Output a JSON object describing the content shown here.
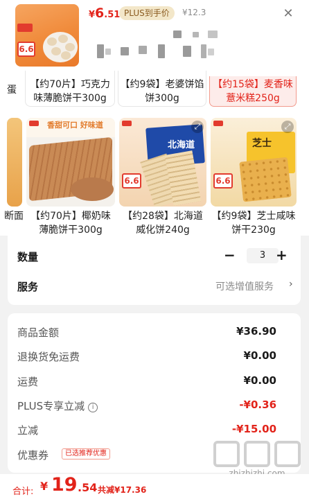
{
  "header": {
    "price": {
      "symbol": "¥",
      "int": "6",
      "dec": ".51"
    },
    "plus_tag": "PLUS到手价",
    "original_price": "¥12.3",
    "close_glyph": "✕",
    "thumb_tag": "6.6"
  },
  "products": [
    {
      "label": "蛋"
    },
    {
      "label": "【约70片】巧克力味薄脆饼干300g"
    },
    {
      "label": "【约9袋】老婆饼馅饼300g"
    },
    {
      "label": "【约15袋】麦香味薏米糕250g"
    },
    {
      "label": "断面"
    },
    {
      "label": "【约70片】椰奶味薄脆饼干300g",
      "banner": "香甜可口 好味道"
    },
    {
      "label": "【约28袋】北海道威化饼240g",
      "banner": "北海道",
      "tag": "6.6"
    },
    {
      "label": "【约9袋】芝士咸味饼干230g",
      "banner": "芝士",
      "tag": "6.6"
    }
  ],
  "quantity": {
    "label": "数量",
    "value": "3",
    "minus": "−",
    "plus": "+"
  },
  "service": {
    "label": "服务",
    "value": "可选增值服务",
    "chevron": "›"
  },
  "fees": [
    {
      "label": "商品金额",
      "value": "¥36.90",
      "red": false
    },
    {
      "label": "退换货免运费",
      "value": "¥0.00",
      "red": false
    },
    {
      "label": "运费",
      "value": "¥0.00",
      "red": false
    },
    {
      "label": "PLUS专享立减",
      "value": "-¥0.36",
      "red": true
    },
    {
      "label": "立减",
      "value": "-¥15.00",
      "red": true
    },
    {
      "label": "优惠券",
      "value": "",
      "red": true
    }
  ],
  "coupon_tag": "已选推荐优惠",
  "total": {
    "label": "合计:",
    "symbol": "¥",
    "int": "19",
    "dec": ".54",
    "save": "共减¥17.36"
  },
  "watermark": {
    "url": "zhizhizhi.com"
  },
  "colors": {
    "accent": "#e2231a",
    "plus_bg": "#f3e7c9"
  }
}
